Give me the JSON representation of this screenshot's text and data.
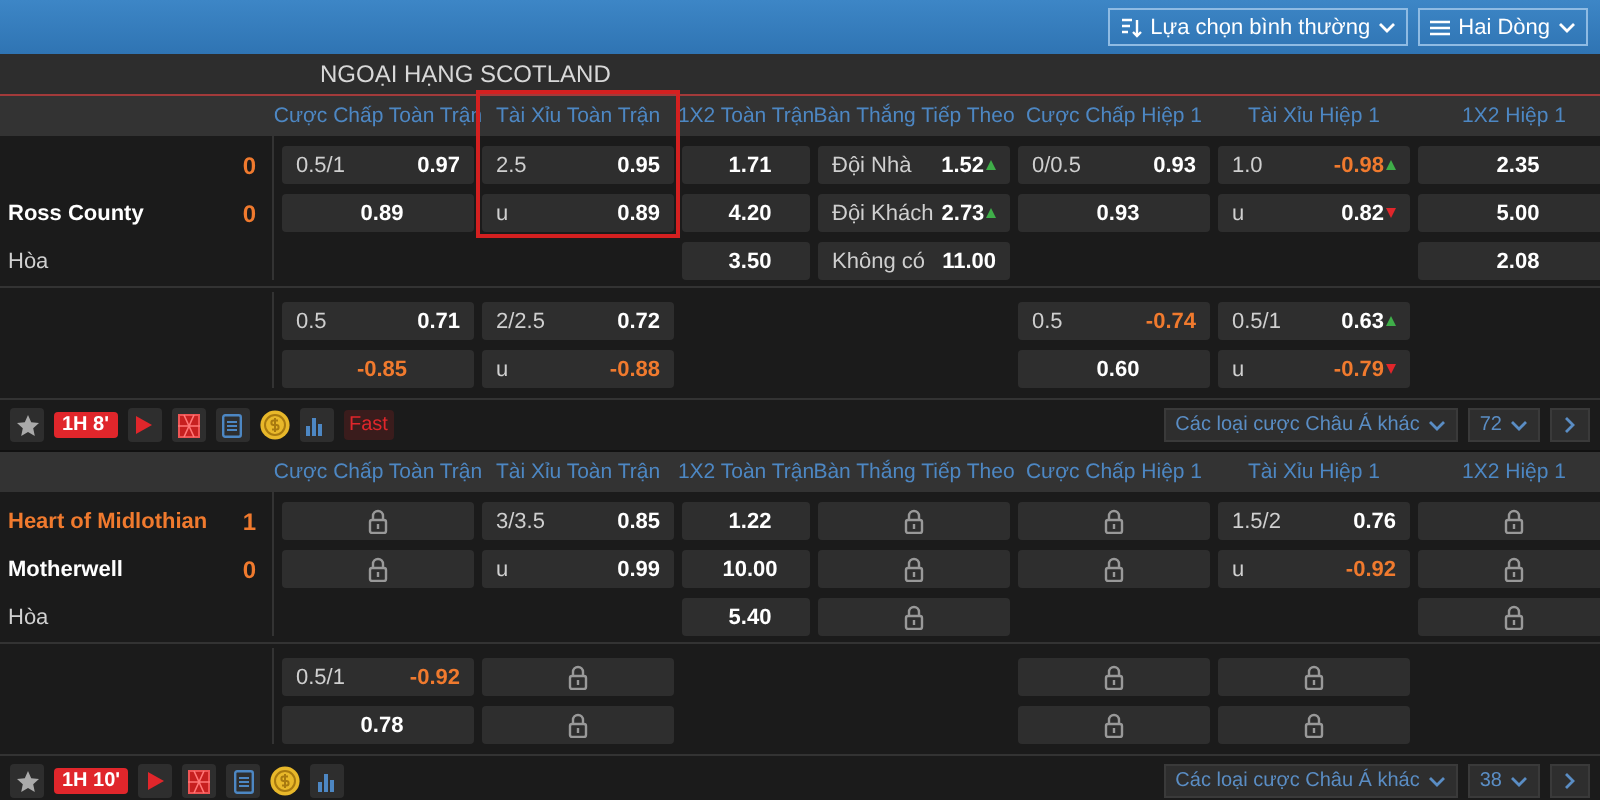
{
  "toolbar": {
    "dropdowns": [
      {
        "kind": "sort",
        "label": "Lựa chọn bình thường"
      },
      {
        "kind": "list",
        "label": "Hai Dòng"
      }
    ]
  },
  "league": {
    "title": "NGOẠI HẠNG SCOTLAND"
  },
  "matches": [
    {
      "columns": [
        {
          "label": "Cược Chấp Toàn Trận",
          "highlighted": false
        },
        {
          "label": "Tài Xỉu Toàn Trận",
          "highlighted": true
        },
        {
          "label": "1X2 Toàn Trận",
          "highlighted": false
        },
        {
          "label": "Bàn Thắng Tiếp Theo",
          "highlighted": false
        },
        {
          "label": "Cược Chấp Hiệp 1",
          "highlighted": false
        },
        {
          "label": "Tài Xỉu Hiệp 1",
          "highlighted": false
        },
        {
          "label": "1X2 Hiệp 1",
          "highlighted": false
        }
      ],
      "teams": [
        {
          "score": "0"
        },
        {
          "name": "Ross County",
          "score": "0",
          "leading": false
        }
      ],
      "draw_label": "Hòa",
      "main": [
        [
          {
            "kind": "odds",
            "line": "0.5/1",
            "price": "0.97"
          },
          {
            "kind": "odds",
            "price": "0.89"
          },
          {
            "kind": "empty"
          }
        ],
        [
          {
            "kind": "odds",
            "line": "2.5",
            "price": "0.95"
          },
          {
            "kind": "odds",
            "line": "u",
            "price": "0.89"
          },
          {
            "kind": "empty"
          }
        ],
        [
          {
            "kind": "odds",
            "price": "1.71"
          },
          {
            "kind": "odds",
            "price": "4.20"
          },
          {
            "kind": "odds",
            "price": "3.50"
          }
        ],
        [
          {
            "kind": "odds",
            "line": "Đội Nhà",
            "price": "1.52",
            "rising": true
          },
          {
            "kind": "odds",
            "line": "Đội Khách",
            "price": "2.73",
            "rising": true
          },
          {
            "kind": "odds",
            "line": "Không có",
            "price": "11.00"
          }
        ],
        [
          {
            "kind": "odds",
            "line": "0/0.5",
            "price": "0.93"
          },
          {
            "kind": "odds",
            "price": "0.93"
          },
          {
            "kind": "empty"
          }
        ],
        [
          {
            "kind": "odds",
            "line": "1.0",
            "price": "-0.98",
            "color": "#f07a2e",
            "rising": true
          },
          {
            "kind": "odds",
            "line": "u",
            "price": "0.82",
            "rising": false
          },
          {
            "kind": "empty"
          }
        ],
        [
          {
            "kind": "odds",
            "price": "2.35"
          },
          {
            "kind": "odds",
            "price": "5.00"
          },
          {
            "kind": "odds",
            "price": "2.08"
          }
        ]
      ],
      "extra": [
        [
          {
            "kind": "odds",
            "line": "0.5",
            "price": "0.71"
          },
          {
            "kind": "odds",
            "price": "-0.85",
            "color": "#f07a2e"
          }
        ],
        [
          {
            "kind": "odds",
            "line": "2/2.5",
            "price": "0.72"
          },
          {
            "kind": "odds",
            "line": "u",
            "price": "-0.88",
            "color": "#f07a2e"
          }
        ],
        [
          {
            "kind": "empty"
          },
          {
            "kind": "empty"
          }
        ],
        [
          {
            "kind": "empty"
          },
          {
            "kind": "empty"
          }
        ],
        [
          {
            "kind": "odds",
            "line": "0.5",
            "price": "-0.74",
            "color": "#f07a2e"
          },
          {
            "kind": "odds",
            "price": "0.60"
          }
        ],
        [
          {
            "kind": "odds",
            "line": "0.5/1",
            "price": "0.63",
            "rising": true
          },
          {
            "kind": "odds",
            "line": "u",
            "price": "-0.79",
            "color": "#f07a2e",
            "rising": false
          }
        ],
        [
          {
            "kind": "empty"
          },
          {
            "kind": "empty"
          }
        ]
      ],
      "footer": {
        "time": "1H 8'",
        "fast_label": "Fast",
        "dropdown": "Các loại cược Châu Á khác",
        "count": "72"
      }
    },
    {
      "columns": [
        {
          "label": "Cược Chấp Toàn Trận",
          "highlighted": false
        },
        {
          "label": "Tài Xỉu Toàn Trận",
          "highlighted": false
        },
        {
          "label": "1X2 Toàn Trận",
          "highlighted": false
        },
        {
          "label": "Bàn Thắng Tiếp Theo",
          "highlighted": false
        },
        {
          "label": "Cược Chấp Hiệp 1",
          "highlighted": false
        },
        {
          "label": "Tài Xỉu Hiệp 1",
          "highlighted": false
        },
        {
          "label": "1X2 Hiệp 1",
          "highlighted": false
        }
      ],
      "teams": [
        {
          "name": "Heart of Midlothian",
          "score": "1",
          "leading": true
        },
        {
          "name": "Motherwell",
          "score": "0",
          "leading": false
        }
      ],
      "draw_label": "Hòa",
      "main": [
        [
          {
            "kind": "locked"
          },
          {
            "kind": "locked"
          },
          {
            "kind": "empty"
          }
        ],
        [
          {
            "kind": "odds",
            "line": "3/3.5",
            "price": "0.85"
          },
          {
            "kind": "odds",
            "line": "u",
            "price": "0.99"
          },
          {
            "kind": "empty"
          }
        ],
        [
          {
            "kind": "odds",
            "price": "1.22"
          },
          {
            "kind": "odds",
            "price": "10.00"
          },
          {
            "kind": "odds",
            "price": "5.40"
          }
        ],
        [
          {
            "kind": "locked"
          },
          {
            "kind": "locked"
          },
          {
            "kind": "locked"
          }
        ],
        [
          {
            "kind": "locked"
          },
          {
            "kind": "locked"
          },
          {
            "kind": "empty"
          }
        ],
        [
          {
            "kind": "odds",
            "line": "1.5/2",
            "price": "0.76"
          },
          {
            "kind": "odds",
            "line": "u",
            "price": "-0.92",
            "color": "#f07a2e"
          },
          {
            "kind": "empty"
          }
        ],
        [
          {
            "kind": "locked"
          },
          {
            "kind": "locked"
          },
          {
            "kind": "locked"
          }
        ]
      ],
      "extra": [
        [
          {
            "kind": "odds",
            "line": "0.5/1",
            "price": "-0.92",
            "color": "#f07a2e"
          },
          {
            "kind": "odds",
            "price": "0.78"
          }
        ],
        [
          {
            "kind": "locked"
          },
          {
            "kind": "locked"
          }
        ],
        [
          {
            "kind": "empty"
          },
          {
            "kind": "empty"
          }
        ],
        [
          {
            "kind": "empty"
          },
          {
            "kind": "empty"
          }
        ],
        [
          {
            "kind": "locked"
          },
          {
            "kind": "locked"
          }
        ],
        [
          {
            "kind": "locked"
          },
          {
            "kind": "locked"
          }
        ],
        [
          {
            "kind": "empty"
          },
          {
            "kind": "empty"
          }
        ]
      ],
      "footer": {
        "time": "1H 10'",
        "dropdown": "Các loại cược Châu Á khác",
        "count": "38"
      }
    }
  ]
}
